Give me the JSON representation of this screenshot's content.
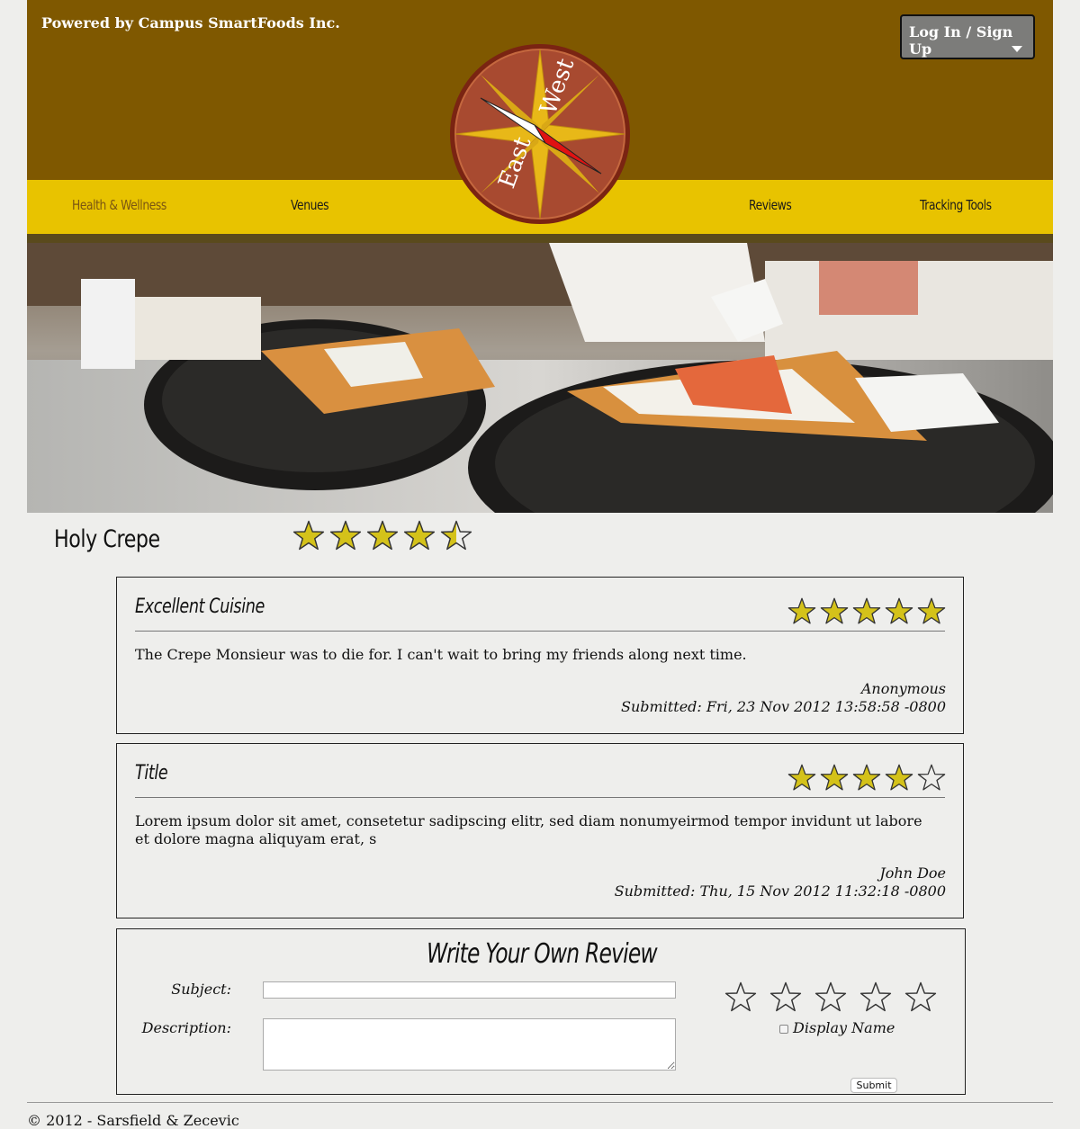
{
  "header": {
    "powered_by": "Powered by Campus SmartFoods Inc.",
    "login_label": "Log In / Sign Up",
    "logo_text_east": "East",
    "logo_text_west": "West"
  },
  "nav": {
    "items": [
      {
        "label": "Health & Wellness",
        "active": true
      },
      {
        "label": "Venues",
        "active": false
      },
      {
        "label": "Reviews",
        "active": false
      },
      {
        "label": "Tracking Tools",
        "active": false
      }
    ]
  },
  "venue": {
    "name": "Holy Crepe",
    "rating": 4.5,
    "rating_max": 5
  },
  "reviews": [
    {
      "title": "Excellent Cuisine",
      "rating": 5,
      "body": "The Crepe Monsieur was to die for. I can't wait to bring my friends along next time.",
      "author": "Anonymous",
      "submitted": "Submitted: Fri, 23 Nov 2012 13:58:58 -0800"
    },
    {
      "title": "Title",
      "rating": 4,
      "body": "Lorem ipsum dolor sit amet, consetetur sadipscing elitr, sed diam nonumyeirmod tempor invidunt ut labore et dolore magna aliquyam erat, s",
      "author": "John Doe",
      "submitted": "Submitted: Thu, 15 Nov 2012 11:32:18 -0800"
    }
  ],
  "write_review": {
    "title": "Write Your Own Review",
    "subject_label": "Subject:",
    "subject_value": "",
    "description_label": "Description:",
    "description_value": "",
    "rating": 0,
    "display_name_label": "Display Name",
    "display_name_checked": false,
    "submit_label": "Submit"
  },
  "footer": {
    "text": "© 2012 - Sarsfield & Zecevic"
  },
  "colors": {
    "header_brown": "#7f5800",
    "nav_yellow": "#e8c300",
    "star_gold": "#d4c21a",
    "logo_red": "#a63a22"
  }
}
